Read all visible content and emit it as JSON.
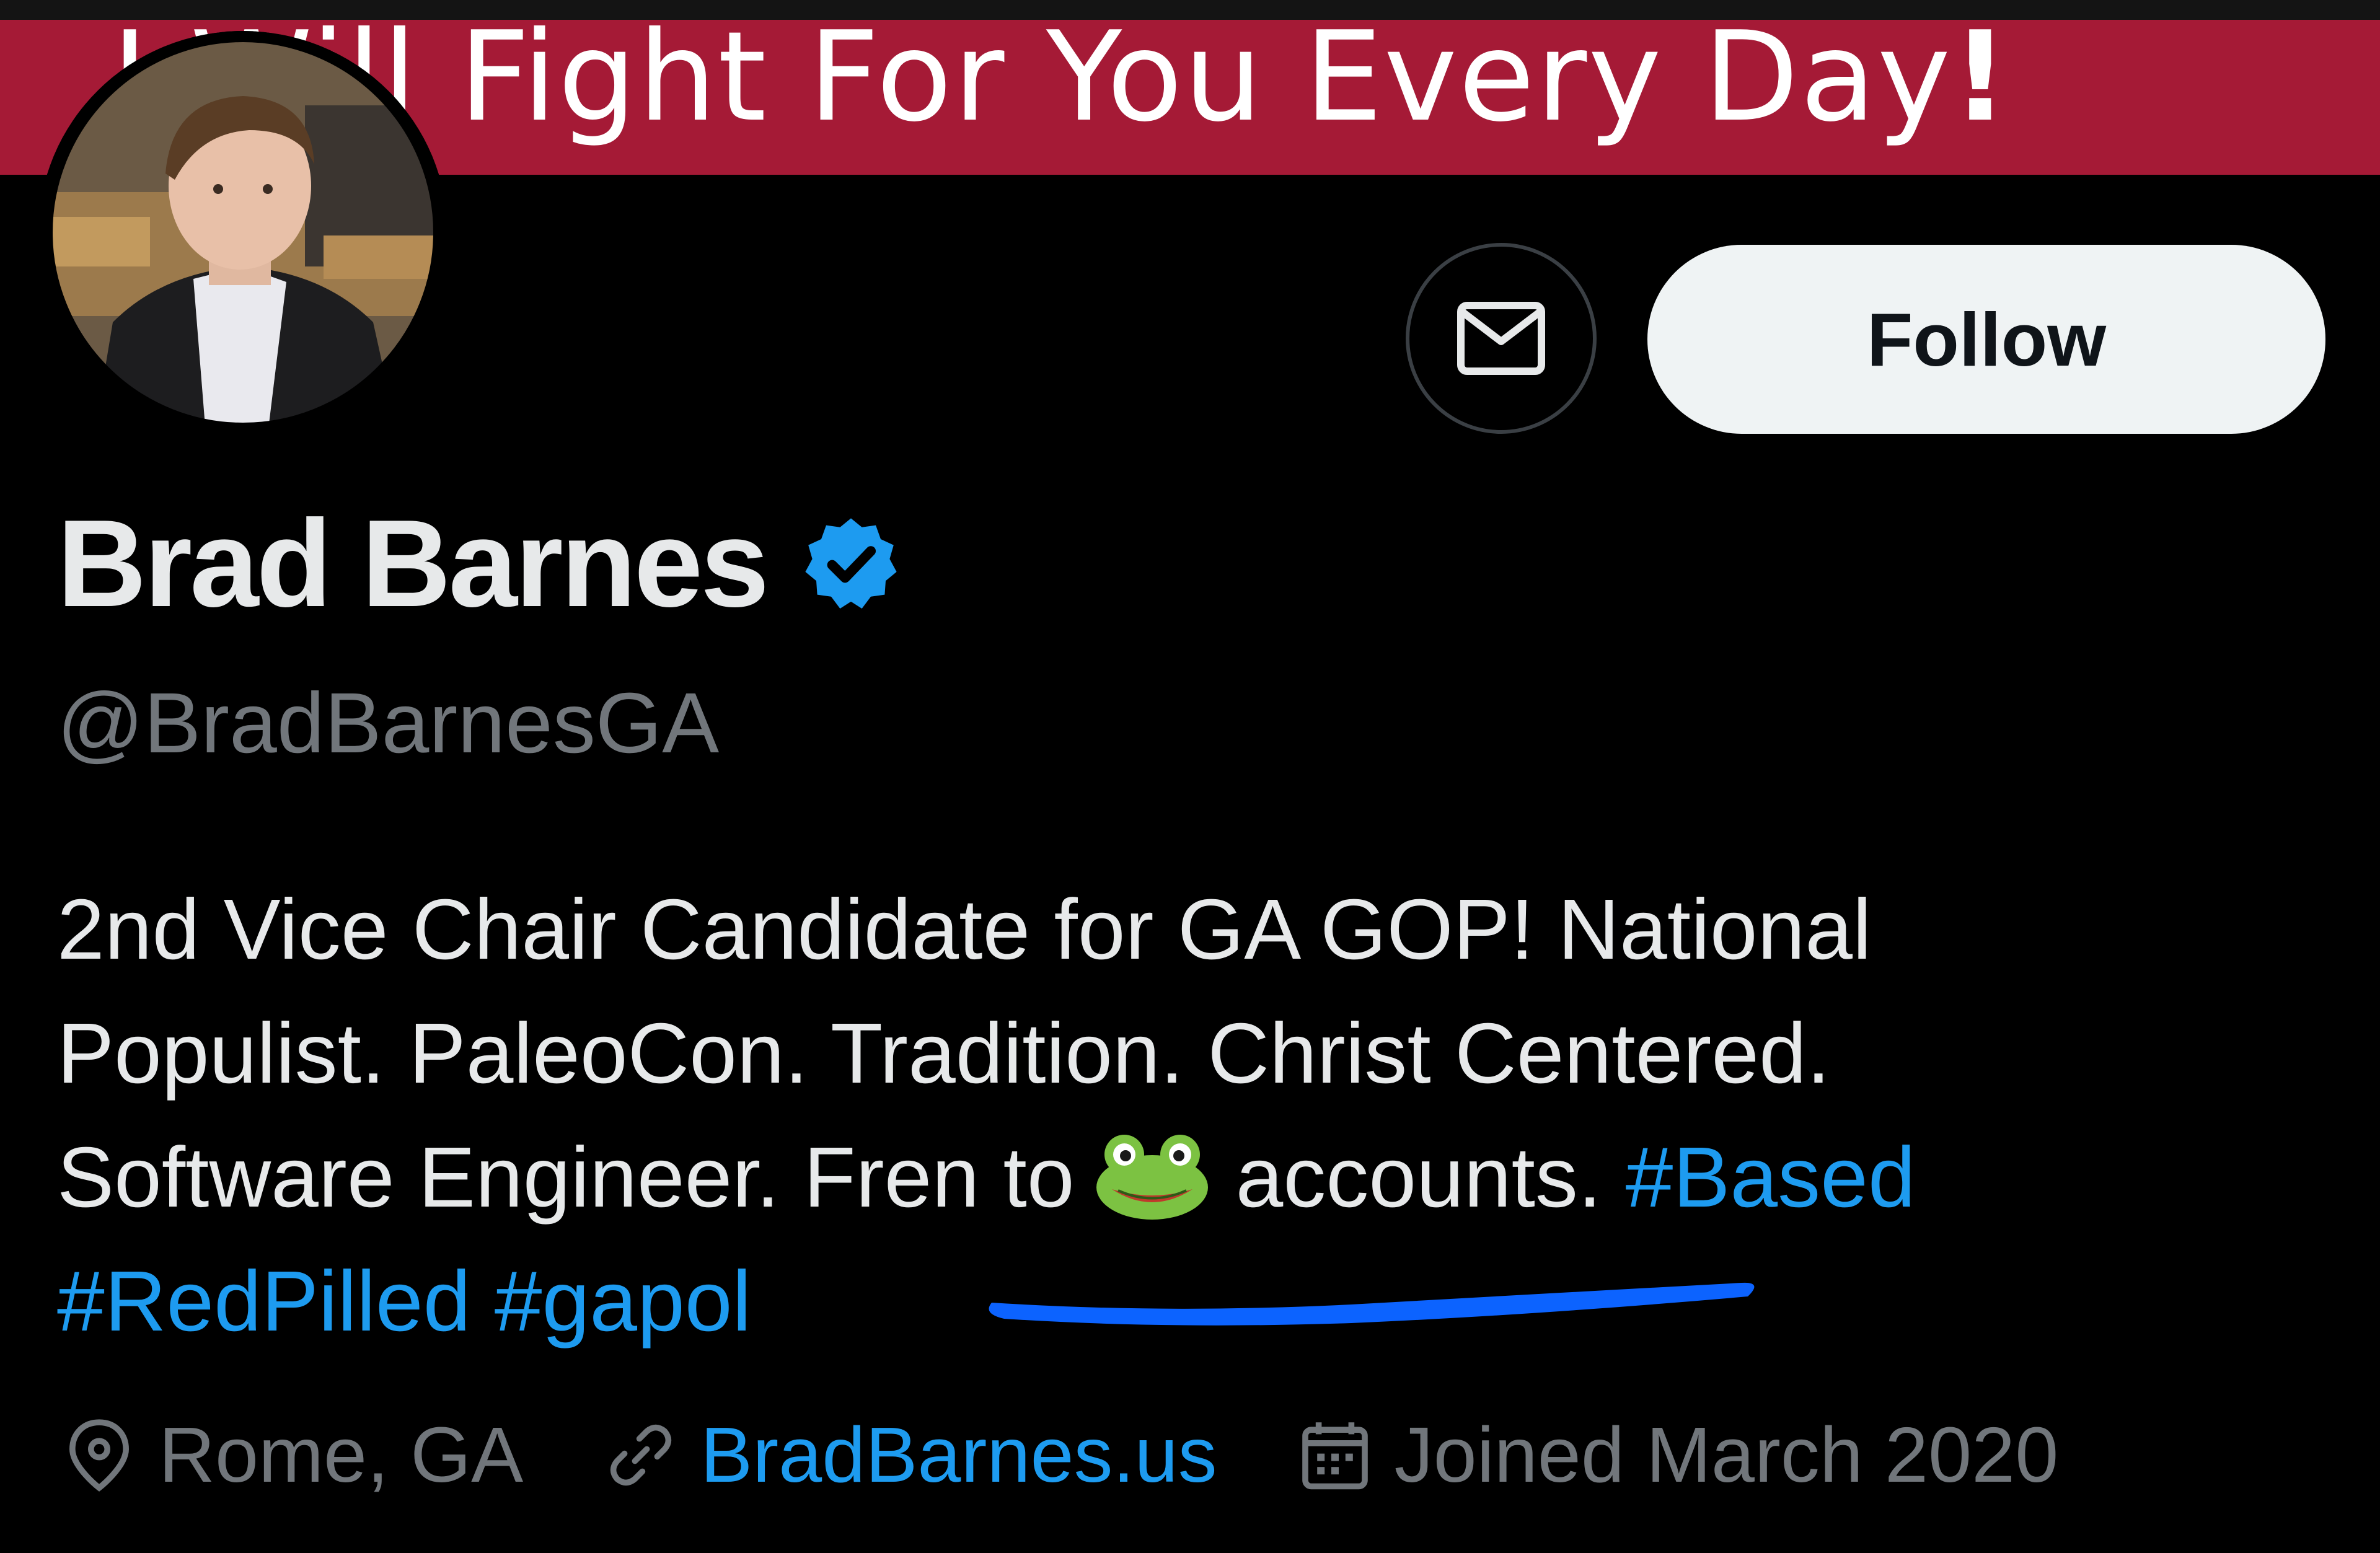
{
  "banner": {
    "text": "I Will Fight For You Every Day",
    "exclaim": "!",
    "color": "#a51a36"
  },
  "profile": {
    "name": "Brad Barnes",
    "verified": true,
    "handle": "@BradBarnesGA",
    "follow_label": "Follow",
    "message_icon": "mail-icon"
  },
  "bio": {
    "line1": "2nd Vice Chair Candidate for GA GOP! National",
    "line2": "Populist. PaleoCon. Tradition. Christ Centered.",
    "line3_a": "Software Engineer. Fren to",
    "line3_emoji": "frog-emoji",
    "line3_b": "accounts.",
    "hashtags": [
      "#Based",
      "#RedPilled",
      "#gapol"
    ]
  },
  "meta": {
    "location": "Rome, GA",
    "website": "BradBarnes.us",
    "joined": "Joined March 2020"
  },
  "colors": {
    "accent": "#1d9bf0",
    "text": "#e7e9ea",
    "muted": "#71767b",
    "background": "#000000"
  }
}
